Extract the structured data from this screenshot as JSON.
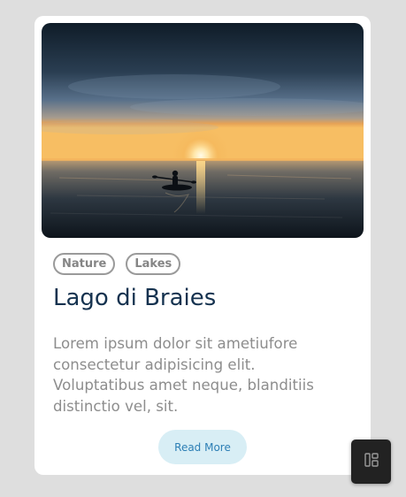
{
  "card": {
    "image_alt": "Kayaker paddling toward the sunset on a calm lake",
    "tags": [
      "Nature",
      "Lakes"
    ],
    "title": "Lago di Braies",
    "description": "Lorem ipsum dolor sit ametiufore consectetur adipisicing elit. Voluptatibus amet neque, blanditiis distinctio vel, sit.",
    "button_label": "Read More"
  },
  "floating_button": {
    "icon": "layout-icon"
  },
  "colors": {
    "page_background": "#dedede",
    "card_background": "#ffffff",
    "title": "#15324f",
    "text": "#8d8d8d",
    "tag_border": "#9a9a9a",
    "button_background": "#d8eef5",
    "button_text": "#2d7fb5",
    "floating_button_background": "#222222"
  }
}
